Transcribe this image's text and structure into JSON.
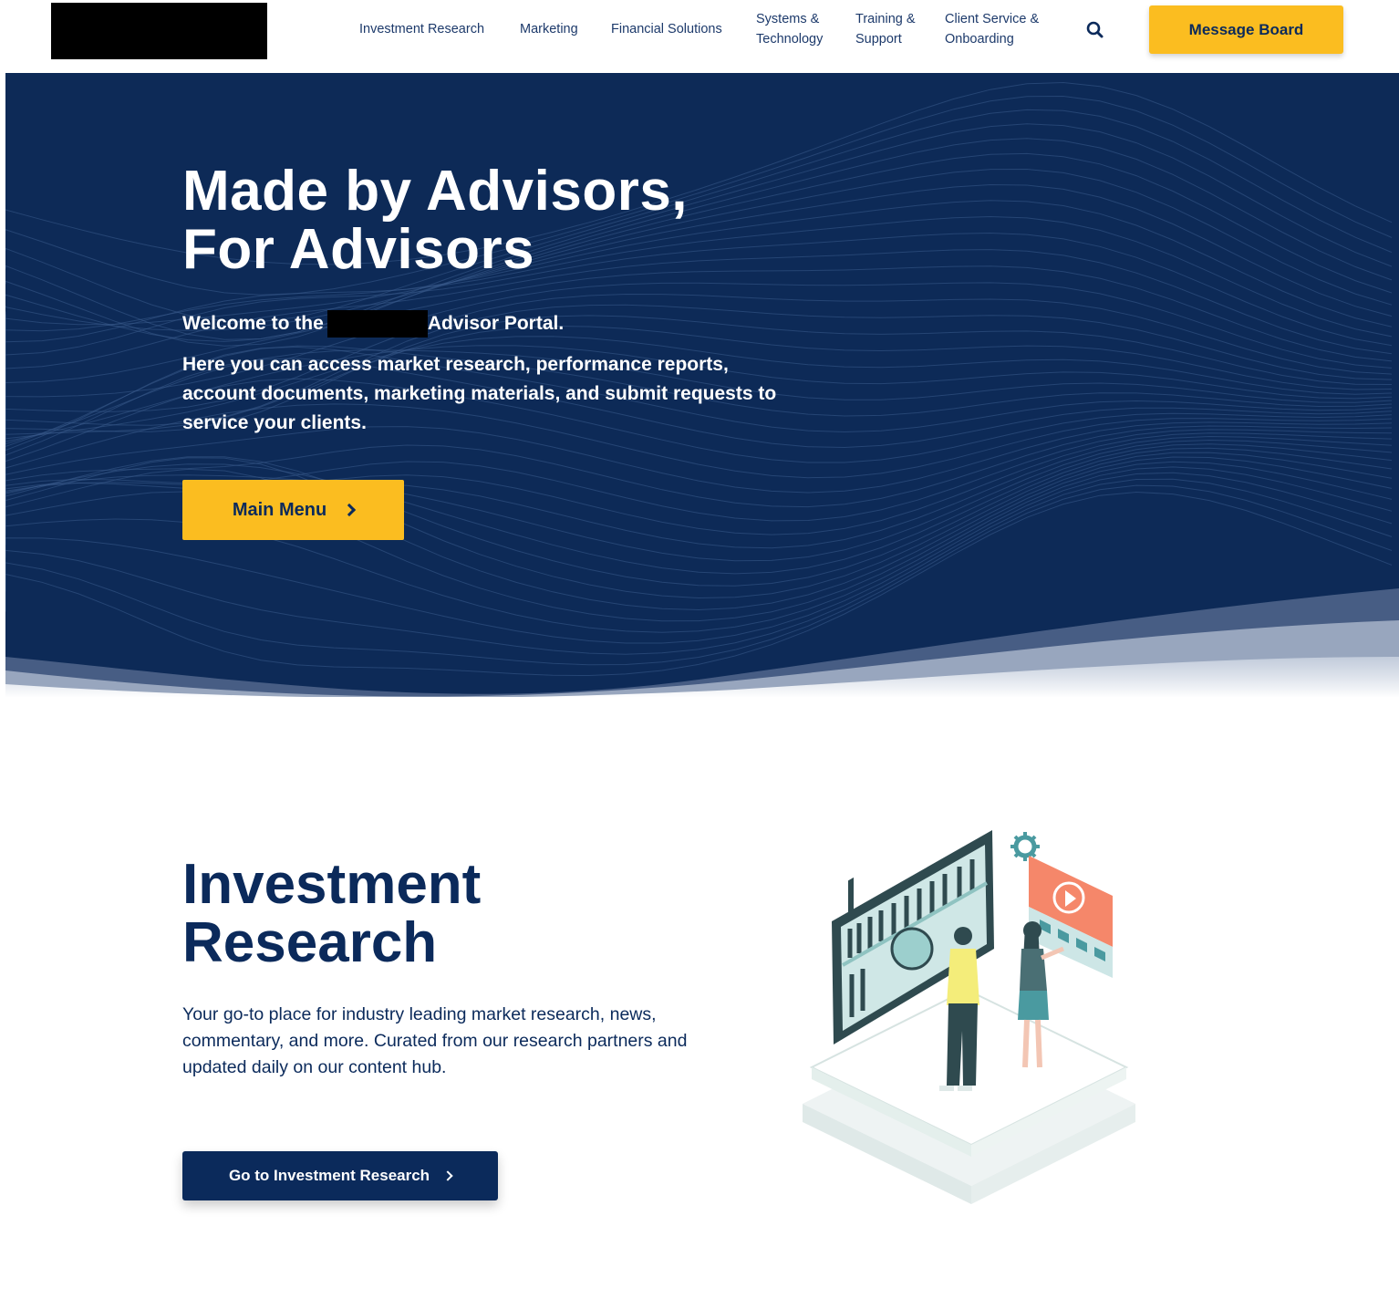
{
  "header": {
    "nav": [
      {
        "label": "Investment Research"
      },
      {
        "label": "Marketing"
      },
      {
        "label": "Financial Solutions"
      },
      {
        "label": "Systems &",
        "label2": "Technology"
      },
      {
        "label": "Training &",
        "label2": "Support"
      },
      {
        "label": "Client Service &",
        "label2": "Onboarding"
      }
    ],
    "search_icon": "search-icon",
    "message_board_label": "Message Board"
  },
  "hero": {
    "title_line1": "Made by Advisors,",
    "title_line2": "For Advisors",
    "welcome_prefix": "Welcome to the",
    "welcome_suffix": "Advisor Portal.",
    "description": "Here you can access market research, performance reports, account documents, marketing materials, and submit requests to service your clients.",
    "main_menu_label": "Main Menu"
  },
  "investment_research": {
    "title_line1": "Investment",
    "title_line2": "Research",
    "description": "Your go-to place for industry leading market research, news, commentary, and more. Curated from our research partners and updated daily on our content hub.",
    "button_label": "Go to Investment Research"
  },
  "colors": {
    "navy": "#0b2a5b",
    "hero_bg": "#0d2a57",
    "accent_yellow": "#fbbd20",
    "nav_text": "#1d3a6b"
  }
}
